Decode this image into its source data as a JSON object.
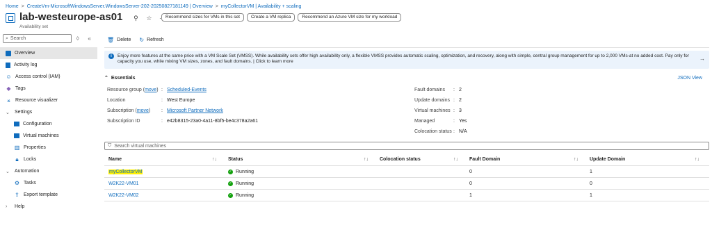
{
  "breadcrumb": [
    "Home",
    "CreateVm-MicrosoftWindowsServer.WindowsServer-202-20250827181149 | Overview",
    "myCollectorVM | Availability + scaling"
  ],
  "breadcrumb_sep": ">",
  "header": {
    "title": "lab-westeurope-as01",
    "subtitle": "Availability set",
    "icons": [
      "pin-icon",
      "star-icon",
      "more-icon"
    ],
    "buttons": [
      "Recommend sizes for VMs in this set",
      "Create a VM replica",
      "Recommend an Azure VM size for my workload"
    ]
  },
  "sidebar": {
    "search_placeholder": "Search",
    "items": [
      {
        "label": "Overview",
        "icon": "overview-icon",
        "active": true
      },
      {
        "label": "Activity log",
        "icon": "activity-log-icon"
      },
      {
        "label": "Access control (IAM)",
        "icon": "iam-icon"
      },
      {
        "label": "Tags",
        "icon": "tag-icon"
      },
      {
        "label": "Resource visualizer",
        "icon": "visualizer-icon"
      },
      {
        "label": "Settings",
        "group": true
      },
      {
        "label": "Configuration",
        "icon": "configuration-icon"
      },
      {
        "label": "Virtual machines",
        "icon": "vm-icon"
      },
      {
        "label": "Properties",
        "icon": "properties-icon"
      },
      {
        "label": "Locks",
        "icon": "lock-icon"
      },
      {
        "label": "Automation",
        "group": true
      },
      {
        "label": "Tasks",
        "icon": "tasks-icon"
      },
      {
        "label": "Export template",
        "icon": "export-icon"
      },
      {
        "label": "Help",
        "group": true,
        "collapsed": true
      }
    ]
  },
  "toolbar": {
    "delete_label": "Delete",
    "refresh_label": "Refresh"
  },
  "banner": {
    "text": "Enjoy more features at the same price with a VM Scale Set (VMSS). While availability sets offer high availability only, a flexible VMSS provides automatic scaling, optimization, and recovery, along with simple, central group management for up to 2,000 VMs-at no added cost. Pay only for capacity you use, while mixing VM sizes, zones, and fault domains. | Click to learn more"
  },
  "essentials": {
    "title": "Essentials",
    "json_view": "JSON View",
    "move": "move",
    "left": {
      "resource_group_label": "Resource group",
      "resource_group": "Scheduled-Events",
      "location_label": "Location",
      "location": "West Europe",
      "subscription_label": "Subscription",
      "subscription": "Microsoft Partner Network",
      "subscription_id_label": "Subscription ID",
      "subscription_id": "e42b8315-23a0-4a11-8bf5-be4c378a2a61"
    },
    "right": {
      "fault_domains_label": "Fault domains",
      "fault_domains": "2",
      "update_domains_label": "Update domains",
      "update_domains": "2",
      "virtual_machines_label": "Virtual machines",
      "virtual_machines": "3",
      "managed_label": "Managed",
      "managed": "Yes",
      "colocation_label": "Colocation status",
      "colocation": "N/A"
    }
  },
  "vm_table": {
    "search_placeholder": "Search virtual machines",
    "columns": [
      "Name",
      "Status",
      "Colocation status",
      "Fault Domain",
      "Update Domain"
    ],
    "rows": [
      {
        "name": "myCollectorVM",
        "status": "Running",
        "colocation": "",
        "fault": "0",
        "update": "1"
      },
      {
        "name": "W2K22-VM01",
        "status": "Running",
        "colocation": "",
        "fault": "0",
        "update": "0"
      },
      {
        "name": "W2K22-VM02",
        "status": "Running",
        "colocation": "",
        "fault": "1",
        "update": "1"
      }
    ]
  },
  "colors": {
    "accent": "#0f6cbd",
    "banner_bg": "#ebf3fc",
    "running": "#13a10e",
    "highlight": "#fff000"
  }
}
